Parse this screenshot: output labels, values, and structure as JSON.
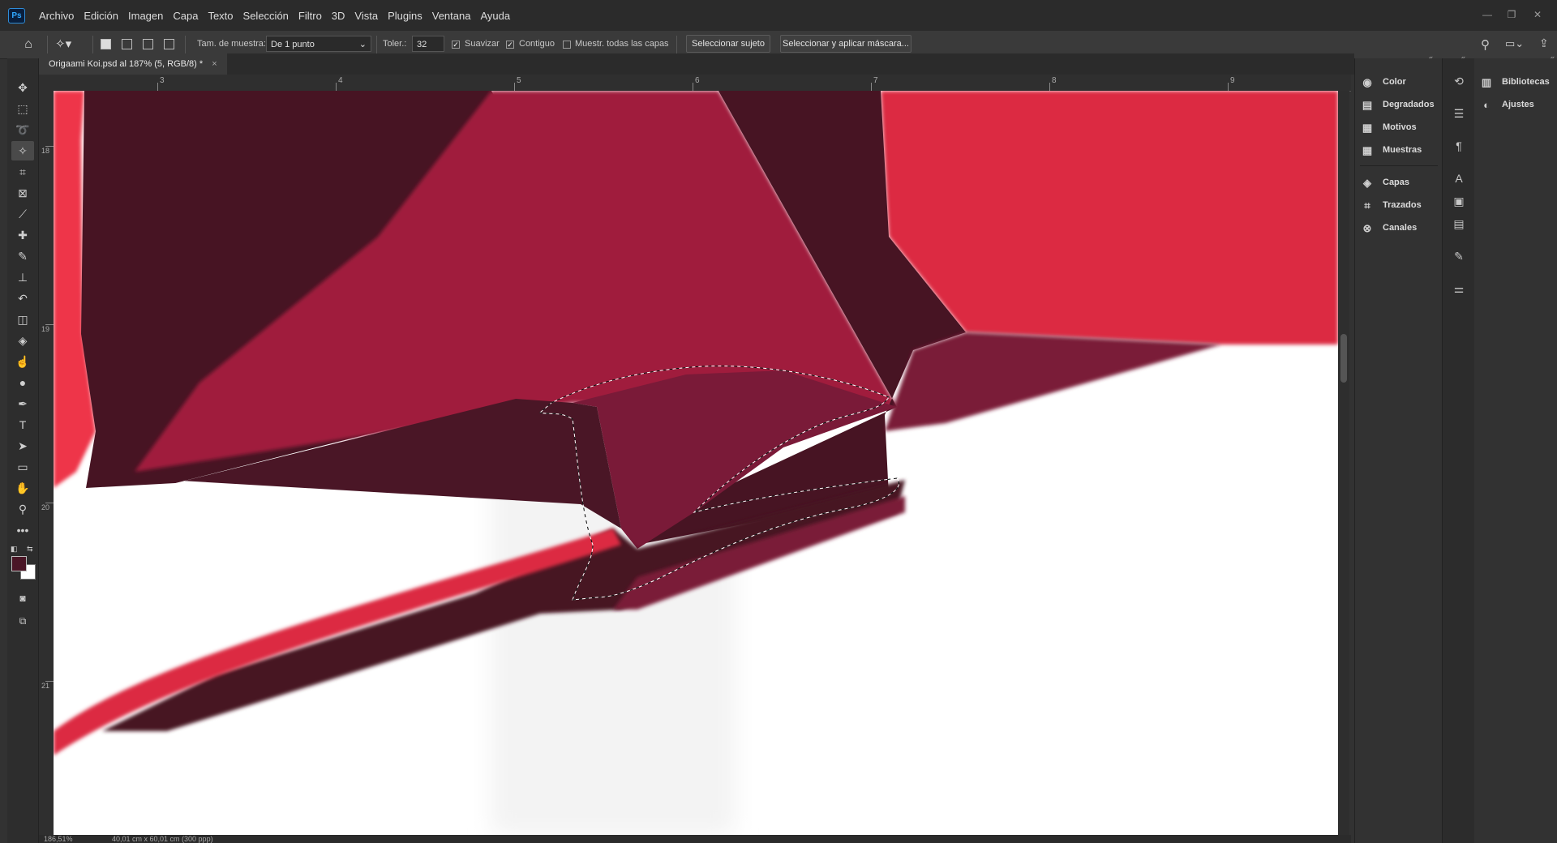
{
  "app": {
    "logo": "Ps"
  },
  "menu": [
    "Archivo",
    "Edición",
    "Imagen",
    "Capa",
    "Texto",
    "Selección",
    "Filtro",
    "3D",
    "Vista",
    "Plugins",
    "Ventana",
    "Ayuda"
  ],
  "window_controls": [
    "minimize-icon",
    "restore-icon",
    "close-icon"
  ],
  "options": {
    "sample_size_label": "Tam. de muestra:",
    "sample_size_value": "De 1 punto",
    "tolerance_label": "Toler.:",
    "tolerance_value": "32",
    "antialias_label": "Suavizar",
    "antialias_checked": true,
    "contiguous_label": "Contiguo",
    "contiguous_checked": true,
    "sample_all_label": "Muestr. todas las capas",
    "sample_all_checked": false,
    "select_subject_label": "Seleccionar sujeto",
    "select_mask_label": "Seleccionar y aplicar máscara..."
  },
  "document": {
    "tab_title": "Origaami Koi.psd al 187% (5, RGB/8) *",
    "status_zoom": "186,51%",
    "status_size": "40,01 cm x 60,01 cm (300 ppp)"
  },
  "rulers": {
    "h": [
      "3",
      "4",
      "5",
      "6",
      "7",
      "8",
      "9"
    ],
    "v": [
      "18",
      "19",
      "20",
      "21"
    ]
  },
  "panels": {
    "group1": [
      "Color",
      "Degradados",
      "Motivos",
      "Muestras"
    ],
    "group2": [
      "Capas",
      "Trazados",
      "Canales"
    ],
    "right": [
      "Bibliotecas",
      "Ajustes"
    ]
  },
  "colors": {
    "foreground": "#4a1626",
    "background": "#ffffff",
    "dark_maroon": "#471423",
    "crimson": "#a01e3c",
    "bright_red": "#dc2a42",
    "mid_wine": "#7a1a38"
  }
}
